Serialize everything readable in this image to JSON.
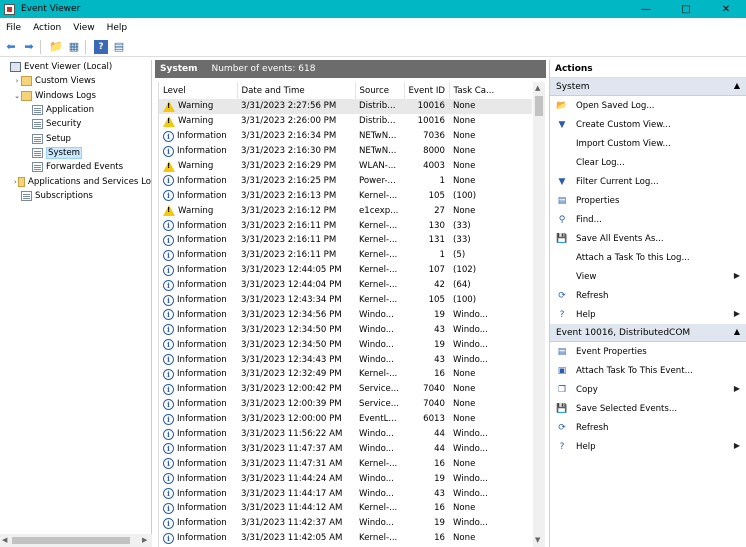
{
  "window": {
    "title": "Event Viewer"
  },
  "menu": [
    "File",
    "Action",
    "View",
    "Help"
  ],
  "tree": {
    "items": [
      {
        "label": "Event Viewer (Local)",
        "depth": 0,
        "twisty": "",
        "icon": "comp",
        "selected": false
      },
      {
        "label": "Custom Views",
        "depth": 1,
        "twisty": "›",
        "icon": "folder",
        "selected": false
      },
      {
        "label": "Windows Logs",
        "depth": 1,
        "twisty": "⌄",
        "icon": "folder",
        "selected": false
      },
      {
        "label": "Application",
        "depth": 2,
        "twisty": "",
        "icon": "log",
        "selected": false
      },
      {
        "label": "Security",
        "depth": 2,
        "twisty": "",
        "icon": "log",
        "selected": false
      },
      {
        "label": "Setup",
        "depth": 2,
        "twisty": "",
        "icon": "log",
        "selected": false
      },
      {
        "label": "System",
        "depth": 2,
        "twisty": "",
        "icon": "log",
        "selected": true
      },
      {
        "label": "Forwarded Events",
        "depth": 2,
        "twisty": "",
        "icon": "log",
        "selected": false
      },
      {
        "label": "Applications and Services Lo",
        "depth": 1,
        "twisty": "›",
        "icon": "folder",
        "selected": false
      },
      {
        "label": "Subscriptions",
        "depth": 1,
        "twisty": "",
        "icon": "log",
        "selected": false
      }
    ]
  },
  "center": {
    "log_name": "System",
    "event_count": "Number of events: 618",
    "columns": [
      "Level",
      "Date and Time",
      "Source",
      "Event ID",
      "Task Ca..."
    ],
    "rows": [
      [
        "Warning",
        "3/31/2023 2:27:56 PM",
        "Distrib...",
        "10016",
        "None"
      ],
      [
        "Warning",
        "3/31/2023 2:26:00 PM",
        "Distrib...",
        "10016",
        "None"
      ],
      [
        "Information",
        "3/31/2023 2:16:34 PM",
        "NETwN...",
        "7036",
        "None"
      ],
      [
        "Information",
        "3/31/2023 2:16:30 PM",
        "NETwN...",
        "8000",
        "None"
      ],
      [
        "Warning",
        "3/31/2023 2:16:29 PM",
        "WLAN-...",
        "4003",
        "None"
      ],
      [
        "Information",
        "3/31/2023 2:16:25 PM",
        "Power-...",
        "1",
        "None"
      ],
      [
        "Information",
        "3/31/2023 2:16:13 PM",
        "Kernel-...",
        "105",
        "(100)"
      ],
      [
        "Warning",
        "3/31/2023 2:16:12 PM",
        "e1cexp...",
        "27",
        "None"
      ],
      [
        "Information",
        "3/31/2023 2:16:11 PM",
        "Kernel-...",
        "130",
        "(33)"
      ],
      [
        "Information",
        "3/31/2023 2:16:11 PM",
        "Kernel-...",
        "131",
        "(33)"
      ],
      [
        "Information",
        "3/31/2023 2:16:11 PM",
        "Kernel-...",
        "1",
        "(5)"
      ],
      [
        "Information",
        "3/31/2023 12:44:05 PM",
        "Kernel-...",
        "107",
        "(102)"
      ],
      [
        "Information",
        "3/31/2023 12:44:04 PM",
        "Kernel-...",
        "42",
        "(64)"
      ],
      [
        "Information",
        "3/31/2023 12:43:34 PM",
        "Kernel-...",
        "105",
        "(100)"
      ],
      [
        "Information",
        "3/31/2023 12:34:56 PM",
        "Windo...",
        "19",
        "Windo..."
      ],
      [
        "Information",
        "3/31/2023 12:34:50 PM",
        "Windo...",
        "43",
        "Windo..."
      ],
      [
        "Information",
        "3/31/2023 12:34:50 PM",
        "Windo...",
        "19",
        "Windo..."
      ],
      [
        "Information",
        "3/31/2023 12:34:43 PM",
        "Windo...",
        "43",
        "Windo..."
      ],
      [
        "Information",
        "3/31/2023 12:32:49 PM",
        "Kernel-...",
        "16",
        "None"
      ],
      [
        "Information",
        "3/31/2023 12:00:42 PM",
        "Service...",
        "7040",
        "None"
      ],
      [
        "Information",
        "3/31/2023 12:00:39 PM",
        "Service...",
        "7040",
        "None"
      ],
      [
        "Information",
        "3/31/2023 12:00:00 PM",
        "EventL...",
        "6013",
        "None"
      ],
      [
        "Information",
        "3/31/2023 11:56:22 AM",
        "Windo...",
        "44",
        "Windo..."
      ],
      [
        "Information",
        "3/31/2023 11:47:37 AM",
        "Windo...",
        "44",
        "Windo..."
      ],
      [
        "Information",
        "3/31/2023 11:47:31 AM",
        "Kernel-...",
        "16",
        "None"
      ],
      [
        "Information",
        "3/31/2023 11:44:24 AM",
        "Windo...",
        "19",
        "Windo..."
      ],
      [
        "Information",
        "3/31/2023 11:44:17 AM",
        "Windo...",
        "43",
        "Windo..."
      ],
      [
        "Information",
        "3/31/2023 11:44:12 AM",
        "Kernel-...",
        "16",
        "None"
      ],
      [
        "Information",
        "3/31/2023 11:42:37 AM",
        "Windo...",
        "19",
        "Windo..."
      ],
      [
        "Information",
        "3/31/2023 11:42:05 AM",
        "Kernel-...",
        "16",
        "None"
      ]
    ]
  },
  "actions": {
    "title": "Actions",
    "sections": [
      {
        "header": "System",
        "items": [
          {
            "label": "Open Saved Log...",
            "icon": "open-log-icon",
            "glyph": "📂",
            "submenu": false
          },
          {
            "label": "Create Custom View...",
            "icon": "filter-icon",
            "glyph": "▼",
            "submenu": false
          },
          {
            "label": "Import Custom View...",
            "icon": "",
            "glyph": "",
            "submenu": false
          },
          {
            "label": "Clear Log...",
            "icon": "",
            "glyph": "",
            "submenu": false
          },
          {
            "label": "Filter Current Log...",
            "icon": "filter-icon",
            "glyph": "▼",
            "submenu": false
          },
          {
            "label": "Properties",
            "icon": "properties-icon",
            "glyph": "▤",
            "submenu": false
          },
          {
            "label": "Find...",
            "icon": "find-icon",
            "glyph": "⚲",
            "submenu": false
          },
          {
            "label": "Save All Events As...",
            "icon": "save-icon",
            "glyph": "💾",
            "submenu": false
          },
          {
            "label": "Attach a Task To this Log...",
            "icon": "",
            "glyph": "",
            "submenu": false
          },
          {
            "label": "View",
            "icon": "",
            "glyph": "",
            "submenu": true
          },
          {
            "label": "Refresh",
            "icon": "refresh-icon",
            "glyph": "⟳",
            "submenu": false
          },
          {
            "label": "Help",
            "icon": "help-icon",
            "glyph": "?",
            "submenu": true
          }
        ]
      },
      {
        "header": "Event 10016, DistributedCOM",
        "items": [
          {
            "label": "Event Properties",
            "icon": "event-properties-icon",
            "glyph": "▤",
            "submenu": false
          },
          {
            "label": "Attach Task To This Event...",
            "icon": "attach-task-icon",
            "glyph": "▣",
            "submenu": false
          },
          {
            "label": "Copy",
            "icon": "copy-icon",
            "glyph": "❐",
            "submenu": true
          },
          {
            "label": "Save Selected Events...",
            "icon": "save-icon",
            "glyph": "💾",
            "submenu": false
          },
          {
            "label": "Refresh",
            "icon": "refresh-icon",
            "glyph": "⟳",
            "submenu": false
          },
          {
            "label": "Help",
            "icon": "help-icon",
            "glyph": "?",
            "submenu": true
          }
        ]
      }
    ]
  }
}
